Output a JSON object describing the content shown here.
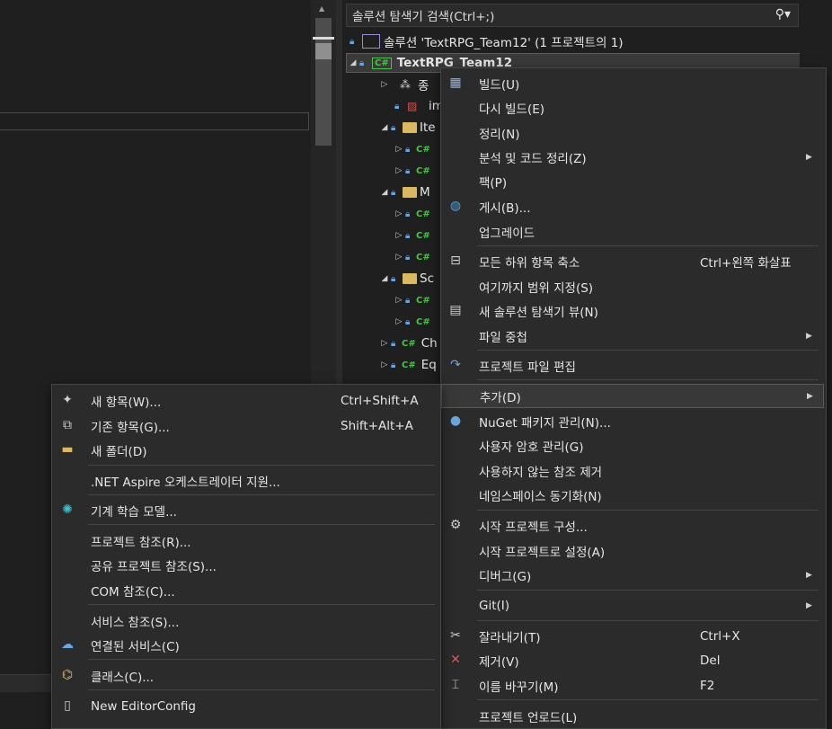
{
  "explorer": {
    "search_placeholder": "솔루션 탐색기 검색(Ctrl+;)",
    "solution_label": "솔루션 'TextRPG_Team12' (1 프로젝트의 1)",
    "project_label": "TextRPG_Team12",
    "rows": {
      "deps": "종",
      "img": "im",
      "items": "Ite",
      "m": "M",
      "sc": "Sc",
      "ch": "Ch",
      "eq": "Eq"
    }
  },
  "project_menu": {
    "items": [
      {
        "label": "빌드(U)",
        "icon": "build-icon"
      },
      {
        "label": "다시 빌드(E)"
      },
      {
        "label": "정리(N)"
      },
      {
        "label": "분석 및 코드 정리(Z)",
        "submenu": true
      },
      {
        "label": "팩(P)"
      },
      {
        "label": "게시(B)...",
        "icon": "globe-icon"
      },
      {
        "label": "업그레이드"
      },
      {
        "label": "모든 하위 항목 축소",
        "shortcut": "Ctrl+왼쪽 화살표",
        "icon": "collapse-icon"
      },
      {
        "label": "여기까지 범위 지정(S)"
      },
      {
        "label": "새 솔루션 탐색기 뷰(N)",
        "icon": "new-view-icon"
      },
      {
        "label": "파일 중첩",
        "submenu": true
      },
      {
        "label": "프로젝트 파일 편집",
        "icon": "redo-arrow-icon"
      },
      {
        "label": "추가(D)",
        "submenu": true
      },
      {
        "label": "NuGet 패키지 관리(N)...",
        "icon": "nuget-icon"
      },
      {
        "label": "사용자 암호 관리(G)"
      },
      {
        "label": "사용하지 않는 참조 제거"
      },
      {
        "label": "네임스페이스 동기화(N)"
      },
      {
        "label": "시작 프로젝트 구성...",
        "icon": "gear-icon"
      },
      {
        "label": "시작 프로젝트로 설정(A)"
      },
      {
        "label": "디버그(G)",
        "submenu": true
      },
      {
        "label": "Git(I)",
        "submenu": true
      },
      {
        "label": "잘라내기(T)",
        "shortcut": "Ctrl+X",
        "icon": "scissors-icon"
      },
      {
        "label": "제거(V)",
        "shortcut": "Del",
        "icon": "remove-x-icon"
      },
      {
        "label": "이름 바꾸기(M)",
        "shortcut": "F2",
        "icon": "rename-icon"
      },
      {
        "label": "프로젝트 언로드(L)"
      }
    ]
  },
  "add_menu": {
    "items": [
      {
        "label": "새 항목(W)...",
        "shortcut": "Ctrl+Shift+A",
        "icon": "new-item-icon"
      },
      {
        "label": "기존 항목(G)...",
        "shortcut": "Shift+Alt+A",
        "icon": "existing-item-icon"
      },
      {
        "label": "새 폴더(D)",
        "icon": "new-folder-icon"
      },
      {
        "label": ".NET Aspire 오케스트레이터 지원..."
      },
      {
        "label": "기계 학습 모델...",
        "icon": "ml-model-icon"
      },
      {
        "label": "프로젝트 참조(R)..."
      },
      {
        "label": "공유 프로젝트 참조(S)..."
      },
      {
        "label": "COM 참조(C)..."
      },
      {
        "label": "서비스 참조(S)..."
      },
      {
        "label": "연결된 서비스(C)",
        "icon": "connected-service-icon"
      },
      {
        "label": "클래스(C)...",
        "icon": "class-icon"
      },
      {
        "label": "New EditorConfig",
        "icon": "file-icon"
      }
    ]
  },
  "colors": {
    "background": "#1f1f1f",
    "menu_bg": "#2b2b2b",
    "csharp_green": "#4fbe4f",
    "lock_blue": "#6aa7e0"
  }
}
